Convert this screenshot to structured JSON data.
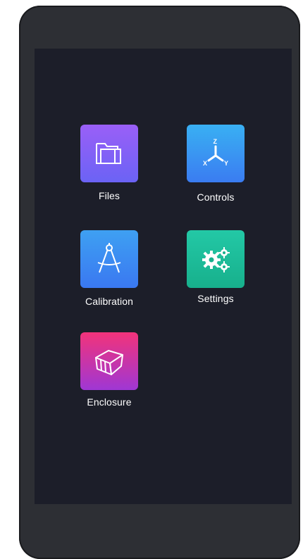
{
  "menu": {
    "files_label": "Files",
    "controls_label": "Controls",
    "calibration_label": "Calibration",
    "settings_label": "Settings",
    "enclosure_label": "Enclosure"
  },
  "icons": {
    "files": "folder-icon",
    "controls": "xyz-axis-icon",
    "calibration": "compass-icon",
    "settings": "gears-icon",
    "enclosure": "box-icon"
  },
  "axis_labels": {
    "z": "Z",
    "x": "X",
    "y": "Y"
  },
  "colors": {
    "screen_bg": "#1c1e29",
    "files": "#8a60f6",
    "controls": "#3a8ef2",
    "calibration": "#3a88f2",
    "settings": "#1fbf9c",
    "enclosure": "#d8357f"
  }
}
